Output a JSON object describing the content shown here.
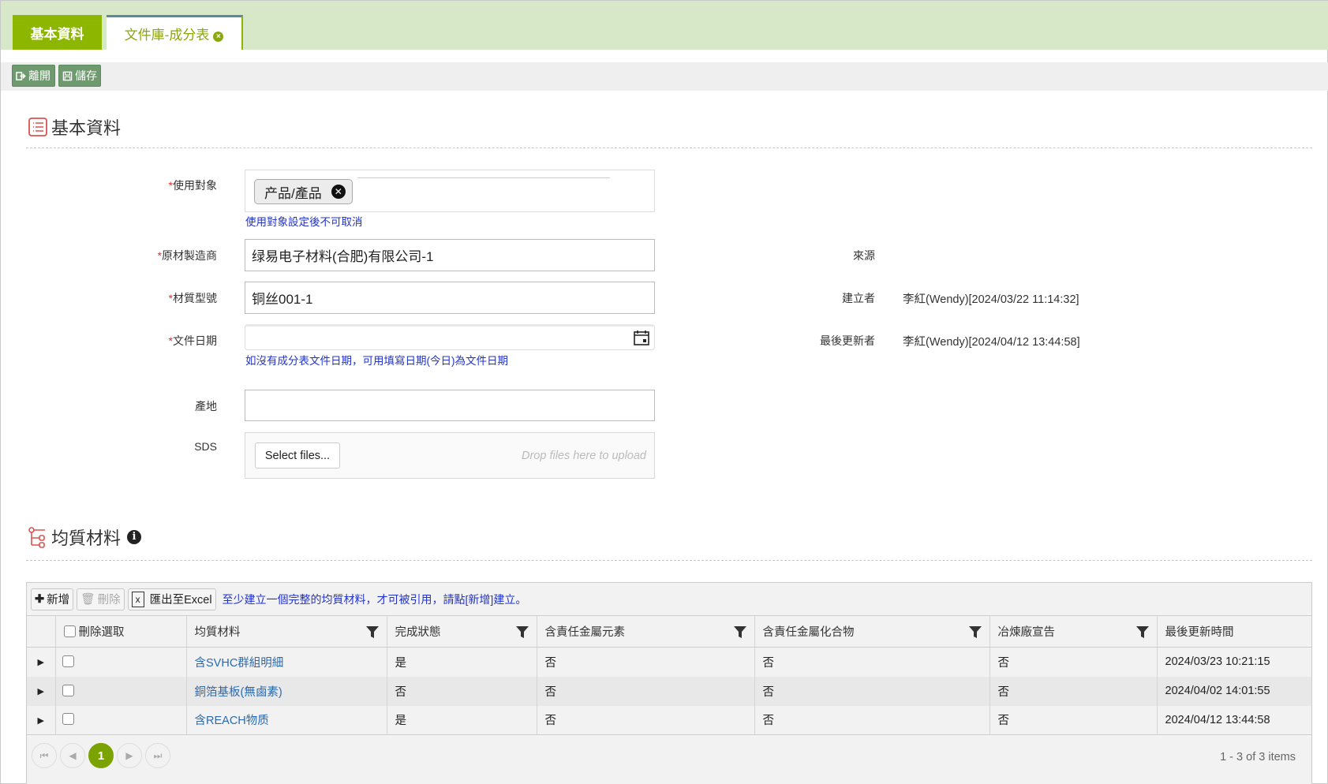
{
  "tabs": [
    {
      "label": "基本資料",
      "active": false
    },
    {
      "label": "文件庫-成分表",
      "active": true,
      "closable": true
    }
  ],
  "toolbar": {
    "exit_label": "離開",
    "save_label": "儲存"
  },
  "section_basic": {
    "title": "基本資料",
    "icon": "list-icon"
  },
  "form": {
    "target": {
      "label": "使用對象",
      "required": true,
      "tag": "产品/產品",
      "hint": "使用對象設定後不可取消"
    },
    "manufacturer": {
      "label": "原材製造商",
      "required": true,
      "value": "绿易电子材料(合肥)有限公司-1"
    },
    "material_model": {
      "label": "材質型號",
      "required": true,
      "value": "铜丝001-1"
    },
    "doc_date": {
      "label": "文件日期",
      "required": true,
      "value": "",
      "hint": "如沒有成分表文件日期，可用填寫日期(今日)為文件日期"
    },
    "origin": {
      "label": "產地",
      "value": ""
    },
    "sds": {
      "label": "SDS",
      "select_label": "Select files...",
      "drop_text": "Drop files here to upload"
    }
  },
  "info": {
    "source": {
      "label": "來源",
      "value": ""
    },
    "creator": {
      "label": "建立者",
      "value": "李紅(Wendy)[2024/03/22 11:14:32]"
    },
    "updater": {
      "label": "最後更新者",
      "value": "李紅(Wendy)[2024/04/12 13:44:58]"
    }
  },
  "section_materials": {
    "title": "均質材料",
    "icon": "hierarchy-icon"
  },
  "grid": {
    "add_label": "新增",
    "delete_label": "刪除",
    "export_label": "匯出至Excel",
    "note": "至少建立一個完整的均質材料，才可被引用，請點[新增]建立。",
    "columns": [
      "刪除選取",
      "均質材料",
      "完成狀態",
      "含責任金屬元素",
      "含責任金屬化合物",
      "冶煉廠宣告",
      "最後更新時間"
    ],
    "rows": [
      {
        "material": "含SVHC群組明細",
        "complete": "是",
        "metal_element": "否",
        "metal_compound": "否",
        "smelter": "否",
        "updated": "2024/03/23 10:21:15"
      },
      {
        "material": "銅箔基板(無鹵素)",
        "complete": "否",
        "metal_element": "否",
        "metal_compound": "否",
        "smelter": "否",
        "updated": "2024/04/02 14:01:55"
      },
      {
        "material": "含REACH物质",
        "complete": "是",
        "metal_element": "否",
        "metal_compound": "否",
        "smelter": "否",
        "updated": "2024/04/12 13:44:58"
      }
    ],
    "pager": {
      "current_page": "1",
      "info": "1 - 3 of 3 items"
    }
  },
  "colors": {
    "accent_green": "#8db600",
    "tab_bar": "#d6e8c8",
    "hint_blue": "#2233cc",
    "link_blue": "#2a6ab0",
    "icon_red": "#d9534f"
  }
}
